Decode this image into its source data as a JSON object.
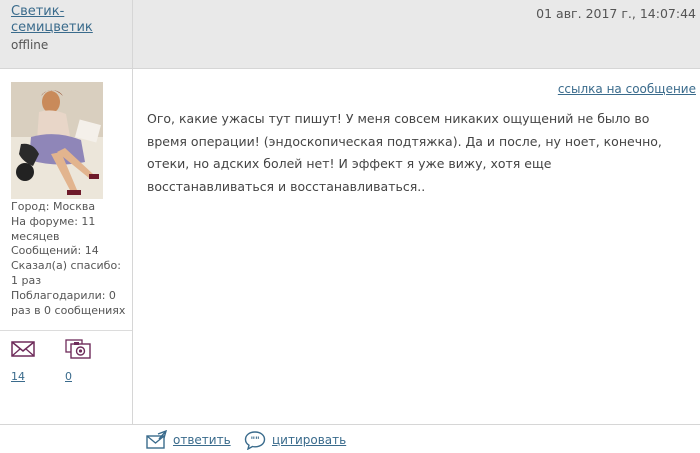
{
  "author": {
    "name": "Светик-семицветик",
    "status": "offline"
  },
  "post": {
    "datetime": "01 авг. 2017 г., 14:07:44",
    "link_label": "ссылка на сообщение",
    "text": "Ого, какие ужасы тут пишут! У меня совсем никаких ощущений не было во время операции! (эндоскопическая подтяжка). Да и после, ну ноет, конечно, отеки, но адских болей нет! И эффект я уже вижу, хотя еще восстанавливаться и восстанавливаться.."
  },
  "profile": {
    "city": "Город: Москва",
    "on_forum": "На форуме: 11 месяцев",
    "messages": "Сообщений: 14",
    "thanked": "Сказал(а) спасибо: 1 раз",
    "received_thanks": "Поблагодарили: 0 раз в 0 сообщениях",
    "pm_count": "14",
    "photo_count": "0",
    "pm_icon": "envelope-icon",
    "photo_icon": "camera-photos-icon"
  },
  "actions": {
    "reply_label": "ответить",
    "quote_label": "цитировать",
    "reply_icon": "reply-envelope-icon",
    "quote_icon": "quote-bubble-icon"
  },
  "colors": {
    "link": "#3a6b8c",
    "icon": "#6e2b5a",
    "header_bg": "#e9e9e9"
  }
}
